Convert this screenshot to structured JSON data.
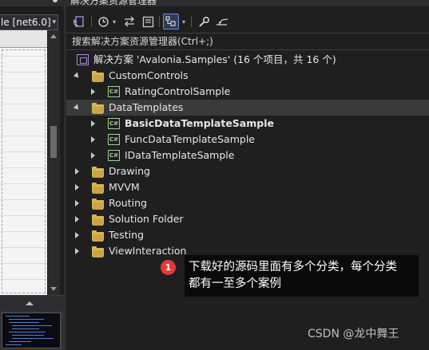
{
  "left_pane": {
    "config_combo_value": "le [net6.0]",
    "config_combo_arrow": "▾"
  },
  "solution_explorer": {
    "title": "解决方案资源管理器",
    "search_placeholder": "搜索解决方案资源管理器(Ctrl+;)",
    "toolbar": {
      "icons": [
        "vs-sync-icon",
        "history-icon",
        "pending-changes-icon",
        "collapse-all-icon",
        "show-all-files-icon",
        "properties-wrench-icon",
        "preview-icon"
      ]
    },
    "tree": [
      {
        "label": "解决方案 'Avalonia.Samples' (16 个项目，共 16 个)",
        "type": "solution",
        "expander": "none",
        "indent": 0,
        "icon": "solution-icon"
      },
      {
        "label": "CustomControls",
        "type": "folder",
        "expander": "expanded",
        "indent": 1,
        "icon": "folder-icon"
      },
      {
        "label": "RatingControlSample",
        "type": "project",
        "expander": "collapsed",
        "indent": 2,
        "icon": "csharp-project-icon"
      },
      {
        "label": "DataTemplates",
        "type": "folder",
        "expander": "expanded",
        "indent": 1,
        "icon": "folder-icon",
        "selected": true
      },
      {
        "label": "BasicDataTemplateSample",
        "type": "project",
        "expander": "collapsed",
        "indent": 2,
        "icon": "csharp-project-icon",
        "bold": true
      },
      {
        "label": "FuncDataTemplateSample",
        "type": "project",
        "expander": "collapsed",
        "indent": 2,
        "icon": "csharp-project-icon"
      },
      {
        "label": "IDataTemplateSample",
        "type": "project",
        "expander": "collapsed",
        "indent": 2,
        "icon": "csharp-project-icon"
      },
      {
        "label": "Drawing",
        "type": "folder",
        "expander": "collapsed",
        "indent": 1,
        "icon": "folder-icon"
      },
      {
        "label": "MVVM",
        "type": "folder",
        "expander": "collapsed",
        "indent": 1,
        "icon": "folder-icon"
      },
      {
        "label": "Routing",
        "type": "folder",
        "expander": "collapsed",
        "indent": 1,
        "icon": "folder-icon"
      },
      {
        "label": "Solution Folder",
        "type": "folder",
        "expander": "collapsed",
        "indent": 1,
        "icon": "folder-icon"
      },
      {
        "label": "Testing",
        "type": "folder",
        "expander": "collapsed",
        "indent": 1,
        "icon": "folder-icon"
      },
      {
        "label": "ViewInteraction",
        "type": "folder",
        "expander": "collapsed",
        "indent": 1,
        "icon": "folder-icon"
      }
    ],
    "csharp_badge": "C#"
  },
  "annotation": {
    "badge": "1",
    "text_line1": "下载好的源码里面有多个分类，每个分类",
    "text_line2": "都有一至多个案例"
  },
  "watermark": "CSDN @龙中舞王",
  "colors": {
    "background": "#1f1f1f",
    "selection": "#3a3a3a",
    "folder": "#d9b65a",
    "csharp": "#9ad49a",
    "badge": "#e53935"
  }
}
